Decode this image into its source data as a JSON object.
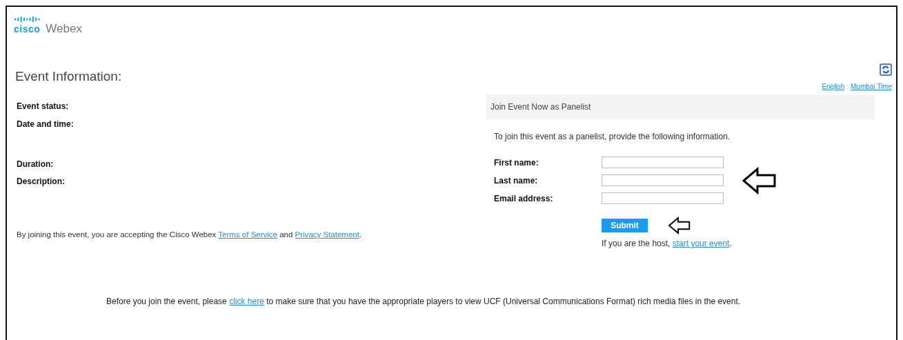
{
  "logo": {
    "wordmark": "cisco",
    "product": "Webex"
  },
  "title": "Event Information:",
  "locale_links": [
    {
      "text": "English"
    },
    {
      "text": "Mumbai Time"
    }
  ],
  "locale_separator": ":",
  "event_fields": [
    {
      "label": "Event status:"
    },
    {
      "label": "Date and time:"
    },
    {
      "label": "Duration:"
    },
    {
      "label": "Description:"
    }
  ],
  "consent": [
    {
      "kind": "text",
      "text": "By joining this event, you are accepting the Cisco Webex "
    },
    {
      "kind": "link",
      "text": "Terms of Service"
    },
    {
      "kind": "text",
      "text": " and "
    },
    {
      "kind": "link",
      "text": "Privacy Statement"
    },
    {
      "kind": "text",
      "text": "."
    }
  ],
  "join_panel": {
    "title": "Join Event Now as Panelist",
    "intro": "To join this event as a panelist, provide the following information.",
    "fields": [
      {
        "label": "First name:"
      },
      {
        "label": "Last name:"
      },
      {
        "label": "Email address:"
      }
    ],
    "submit": "Submit",
    "host_note": [
      {
        "kind": "text",
        "text": "If you are the host, "
      },
      {
        "kind": "link",
        "text": "start your event"
      },
      {
        "kind": "text",
        "text": "."
      }
    ]
  },
  "players_note": [
    {
      "kind": "text",
      "text": "Before you join the event, please "
    },
    {
      "kind": "link",
      "text": "click here"
    },
    {
      "kind": "text",
      "text": " to make sure that you have the appropriate players to view UCF (Universal Communications Format) rich media files in the event."
    }
  ]
}
